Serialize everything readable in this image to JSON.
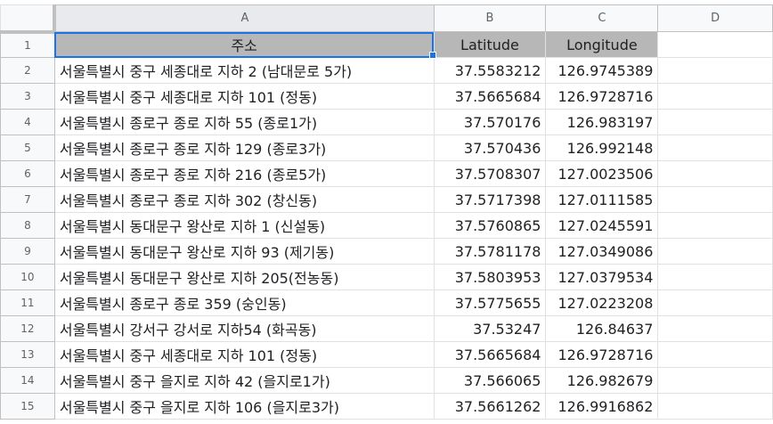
{
  "columns": [
    "A",
    "B",
    "C",
    "D"
  ],
  "header_row": {
    "row_number": "1",
    "address": "주소",
    "latitude": "Latitude",
    "longitude": "Longitude"
  },
  "rows": [
    {
      "n": "2",
      "address": "서울특별시 중구 세종대로 지하 2 (남대문로 5가)",
      "lat": "37.5583212",
      "lng": "126.9745389"
    },
    {
      "n": "3",
      "address": "서울특별시 중구 세종대로 지하 101 (정동)",
      "lat": "37.5665684",
      "lng": "126.9728716"
    },
    {
      "n": "4",
      "address": "서울특별시 종로구 종로 지하 55 (종로1가)",
      "lat": "37.570176",
      "lng": "126.983197"
    },
    {
      "n": "5",
      "address": "서울특별시 종로구 종로 지하 129 (종로3가)",
      "lat": "37.570436",
      "lng": "126.992148"
    },
    {
      "n": "6",
      "address": "서울특별시 종로구 종로 지하 216 (종로5가)",
      "lat": "37.5708307",
      "lng": "127.0023506"
    },
    {
      "n": "7",
      "address": "서울특별시 종로구 종로 지하 302 (창신동)",
      "lat": "37.5717398",
      "lng": "127.0111585"
    },
    {
      "n": "8",
      "address": "서울특별시 동대문구 왕산로 지하 1 (신설동)",
      "lat": "37.5760865",
      "lng": "127.0245591"
    },
    {
      "n": "9",
      "address": "서울특별시 동대문구 왕산로 지하 93 (제기동)",
      "lat": "37.5781178",
      "lng": "127.0349086"
    },
    {
      "n": "10",
      "address": "서울특별시 동대문구 왕산로 지하 205(전농동)",
      "lat": "37.5803953",
      "lng": "127.0379534"
    },
    {
      "n": "11",
      "address": "서울특별시 종로구 종로 359 (숭인동)",
      "lat": "37.5775655",
      "lng": "127.0223208"
    },
    {
      "n": "12",
      "address": "서울특별시 강서구 강서로 지하54 (화곡동)",
      "lat": "37.53247",
      "lng": "126.84637"
    },
    {
      "n": "13",
      "address": "서울특별시 중구 세종대로 지하 101 (정동)",
      "lat": "37.5665684",
      "lng": "126.9728716"
    },
    {
      "n": "14",
      "address": "서울특별시 중구 을지로 지하 42 (을지로1가)",
      "lat": "37.566065",
      "lng": "126.982679"
    },
    {
      "n": "15",
      "address": "서울특별시 중구 을지로 지하 106 (을지로3가)",
      "lat": "37.5661262",
      "lng": "126.9916862"
    }
  ],
  "colors": {
    "header_fill": "#b7b7b7",
    "selection": "#1a73e8",
    "gridline": "#e1e1e1"
  }
}
